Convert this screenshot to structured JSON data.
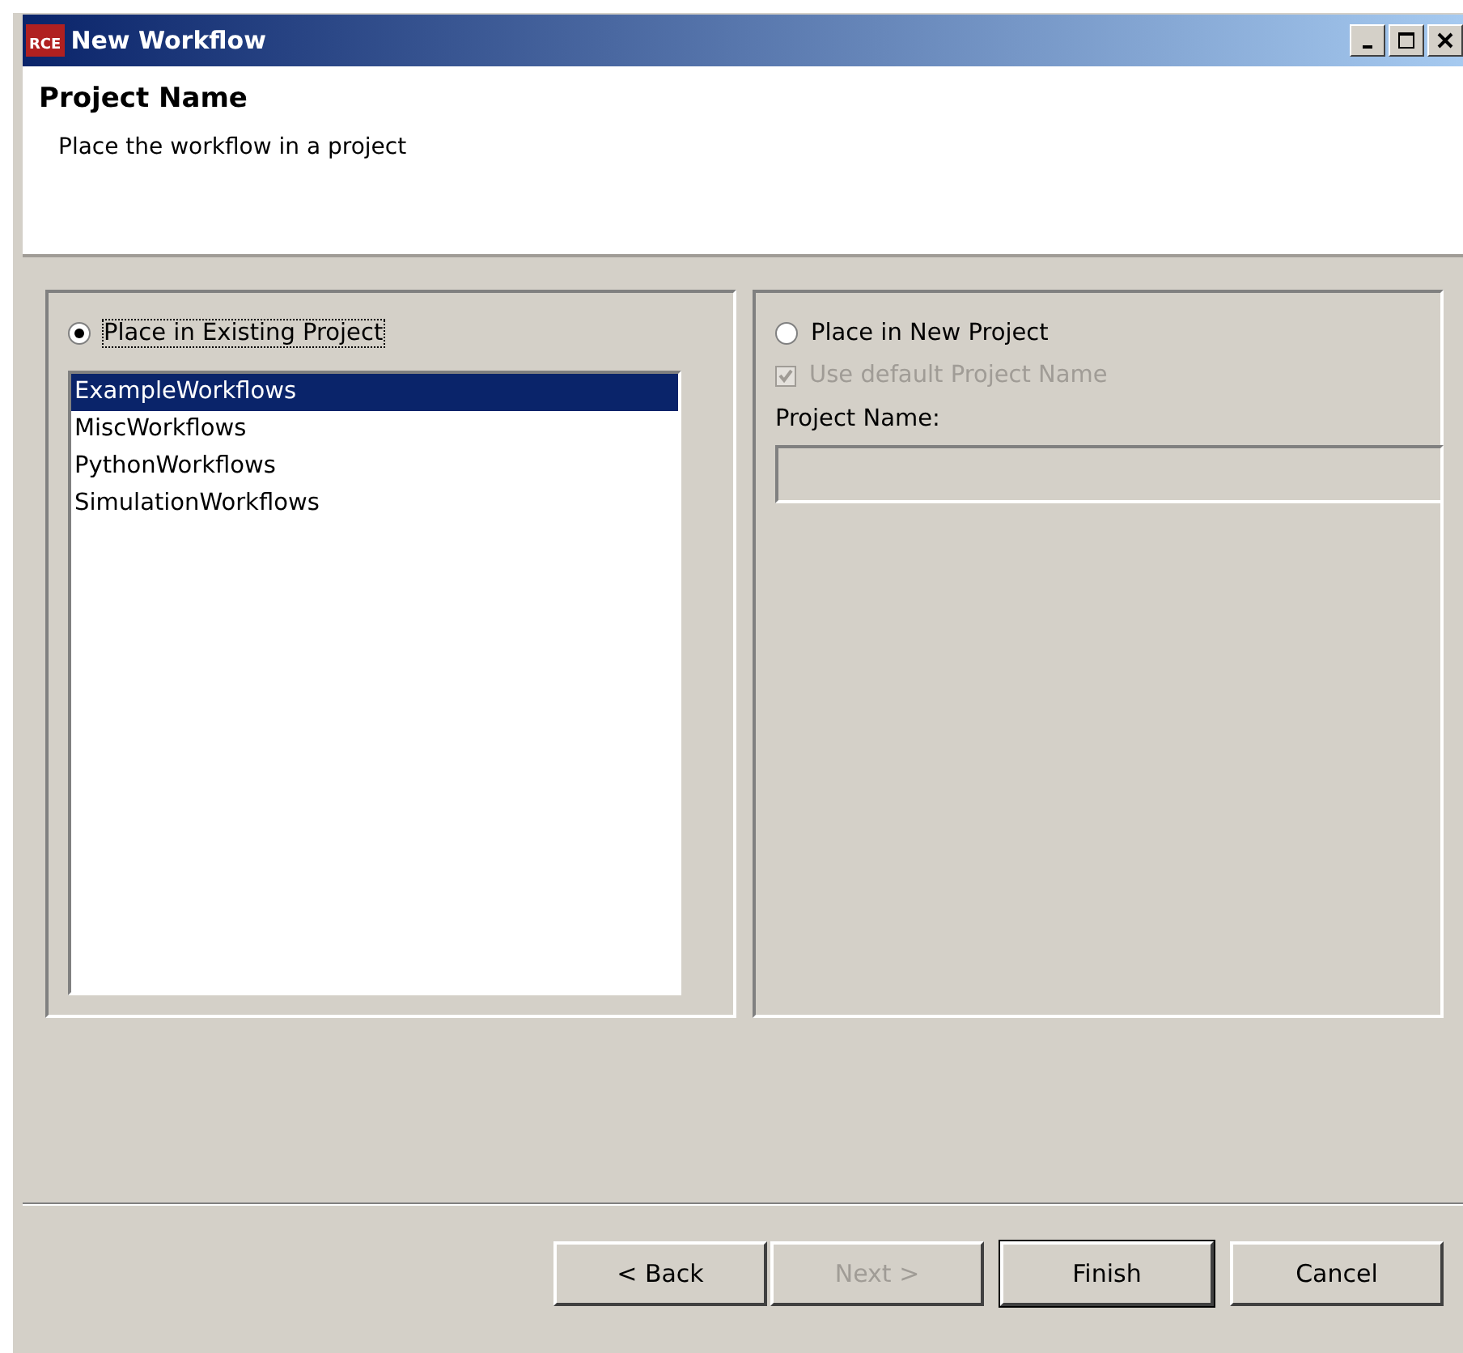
{
  "window": {
    "title": "New Workflow",
    "logo": "RCE"
  },
  "header": {
    "title": "Project Name",
    "description": "Place the workflow in a project"
  },
  "existing": {
    "label": "Place in Existing Project",
    "selected": true,
    "projects": [
      {
        "label": "ExampleWorkflows",
        "selected": true
      },
      {
        "label": "MiscWorkflows",
        "selected": false
      },
      {
        "label": "PythonWorkflows",
        "selected": false
      },
      {
        "label": "SimulationWorkflows",
        "selected": false
      }
    ]
  },
  "new_project": {
    "label": "Place in New Project",
    "selected": false,
    "use_default": {
      "label": "Use default Project Name",
      "checked": true,
      "disabled": true
    },
    "name_label": "Project Name:"
  },
  "buttons": [
    {
      "label": "< Back",
      "disabled": false,
      "default": false
    },
    {
      "label": "Next >",
      "disabled": true,
      "default": false
    },
    {
      "label": "Finish",
      "disabled": false,
      "default": true
    },
    {
      "label": "Cancel",
      "disabled": false,
      "default": false
    }
  ]
}
